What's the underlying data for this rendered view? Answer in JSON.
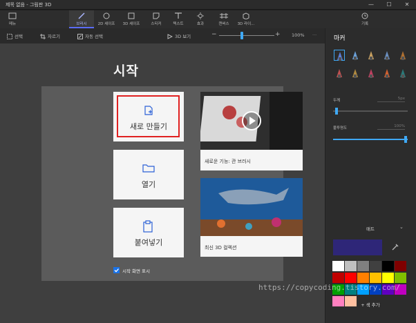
{
  "window": {
    "title": "제목 없음 - 그림판 3D"
  },
  "ribbon": {
    "menu_label": "메뉴",
    "tools": [
      {
        "label": "브러시",
        "active": true
      },
      {
        "label": "2D 셰이프"
      },
      {
        "label": "3D 셰이프"
      },
      {
        "label": "스티커"
      },
      {
        "label": "텍스트"
      },
      {
        "label": "효과"
      },
      {
        "label": "캔버스"
      },
      {
        "label": "3D 라이..."
      }
    ],
    "history_label": "기록"
  },
  "toolbar": {
    "select_label": "선택",
    "crop_label": "자르기",
    "magic_select_label": "자동 선택",
    "view3d_label": "3D 보기",
    "zoom_out": "−",
    "zoom_in": "+",
    "zoom_percent": "100%"
  },
  "start": {
    "title": "시작",
    "new_label": "새로 만들기",
    "open_label": "열기",
    "paste_label": "붙여넣기",
    "video_caption": "새로운 기능: 관 브러시",
    "collection_caption": "최신 3D 컬렉션",
    "show_on_start_label": "시작 화면 표시"
  },
  "panel": {
    "title": "마커",
    "thickness_label": "두께",
    "thickness_value": "5px",
    "opacity_label": "불투명도",
    "opacity_value": "100%",
    "matte_label": "매트",
    "add_color_label": "+ 색 추가",
    "brush_colors": [
      "#5a7fd8",
      "#6aa0d8",
      "#c8a060",
      "#6a8fc0",
      "#b07030",
      "#c05050",
      "#b08a40",
      "#c04060",
      "#d06030",
      "#2a7a7a"
    ],
    "palette": [
      "#ffffff",
      "#c0c0c0",
      "#808080",
      "#404040",
      "#000000",
      "#800000",
      "#c00000",
      "#ff0000",
      "#ff8000",
      "#ffc000",
      "#ffff00",
      "#80c000",
      "#00a000",
      "#008080",
      "#00a0ff",
      "#0040c0",
      "#6000c0",
      "#c000c0",
      "#ff80c0",
      "#ffc0a0"
    ],
    "selected_color": "#2e2678"
  },
  "watermark": "https://copycoding.tistory.com/"
}
